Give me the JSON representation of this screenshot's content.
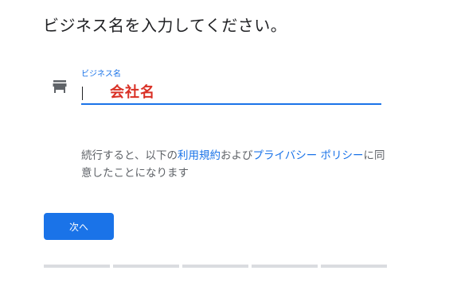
{
  "page": {
    "title": "ビジネス名を入力してください。"
  },
  "business_name_field": {
    "label": "ビジネス名",
    "value": "会社名",
    "icon": "store-icon"
  },
  "terms": {
    "prefix": "続行すると、以下の",
    "terms_link": "利用規約",
    "middle": "および",
    "privacy_link": "プライバシー ポリシー",
    "suffix": "に同意したことになります"
  },
  "actions": {
    "next_label": "次へ"
  },
  "progress": {
    "steps": 5
  },
  "colors": {
    "accent": "#1a73e8",
    "value_text": "#d93025",
    "body_text": "#5f6368",
    "title_text": "#202124"
  }
}
